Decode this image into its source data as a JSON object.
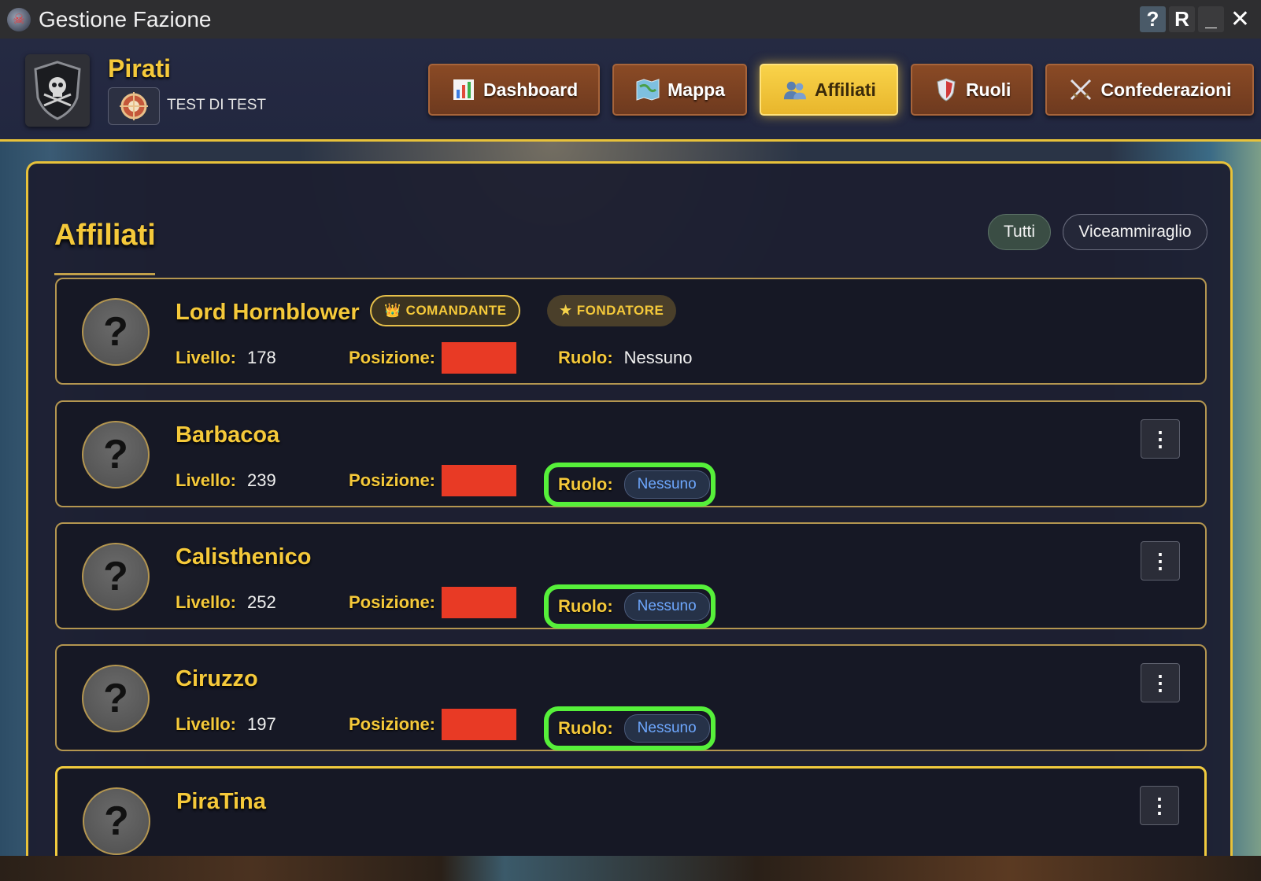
{
  "window": {
    "title": "Gestione Fazione",
    "buttons": {
      "help": "?",
      "reload": "R",
      "minimize": "_",
      "close": "✕"
    }
  },
  "header": {
    "faction_name": "Pirati",
    "faction_subtitle": "TEST DI TEST",
    "nav": [
      {
        "label": "Dashboard",
        "icon": "bar-chart-icon",
        "active": false
      },
      {
        "label": "Mappa",
        "icon": "map-icon",
        "active": false
      },
      {
        "label": "Affiliati",
        "icon": "users-icon",
        "active": true
      },
      {
        "label": "Ruoli",
        "icon": "shield-icon",
        "active": false
      },
      {
        "label": "Confederazioni",
        "icon": "crossed-swords-icon",
        "active": false
      }
    ]
  },
  "panel": {
    "title": "Affiliati",
    "filters": [
      "Tutti",
      "Viceammiraglio"
    ],
    "labels": {
      "level": "Livello:",
      "position": "Posizione:",
      "role": "Ruolo:"
    },
    "members": [
      {
        "name": "Lord Hornblower",
        "level": "178",
        "role": "Nessuno",
        "badges": [
          "COMANDANTE",
          "FONDATORE"
        ],
        "avatar": "?"
      },
      {
        "name": "Barbacoa",
        "level": "239",
        "role": "Nessuno",
        "avatar": "?",
        "menu": "⋮"
      },
      {
        "name": "Calisthenico",
        "level": "252",
        "role": "Nessuno",
        "avatar": "?",
        "menu": "⋮"
      },
      {
        "name": "Ciruzzo",
        "level": "197",
        "role": "Nessuno",
        "avatar": "?",
        "menu": "⋮"
      },
      {
        "name": "PiraTina",
        "avatar": "?",
        "menu": "⋮"
      }
    ]
  },
  "colors": {
    "accent_gold": "#f5c93a",
    "nav_brown": "#8a4a25",
    "position_redacted": "#e83a25",
    "role_highlight": "#56f03a",
    "role_pill_text": "#6ea8ff"
  }
}
